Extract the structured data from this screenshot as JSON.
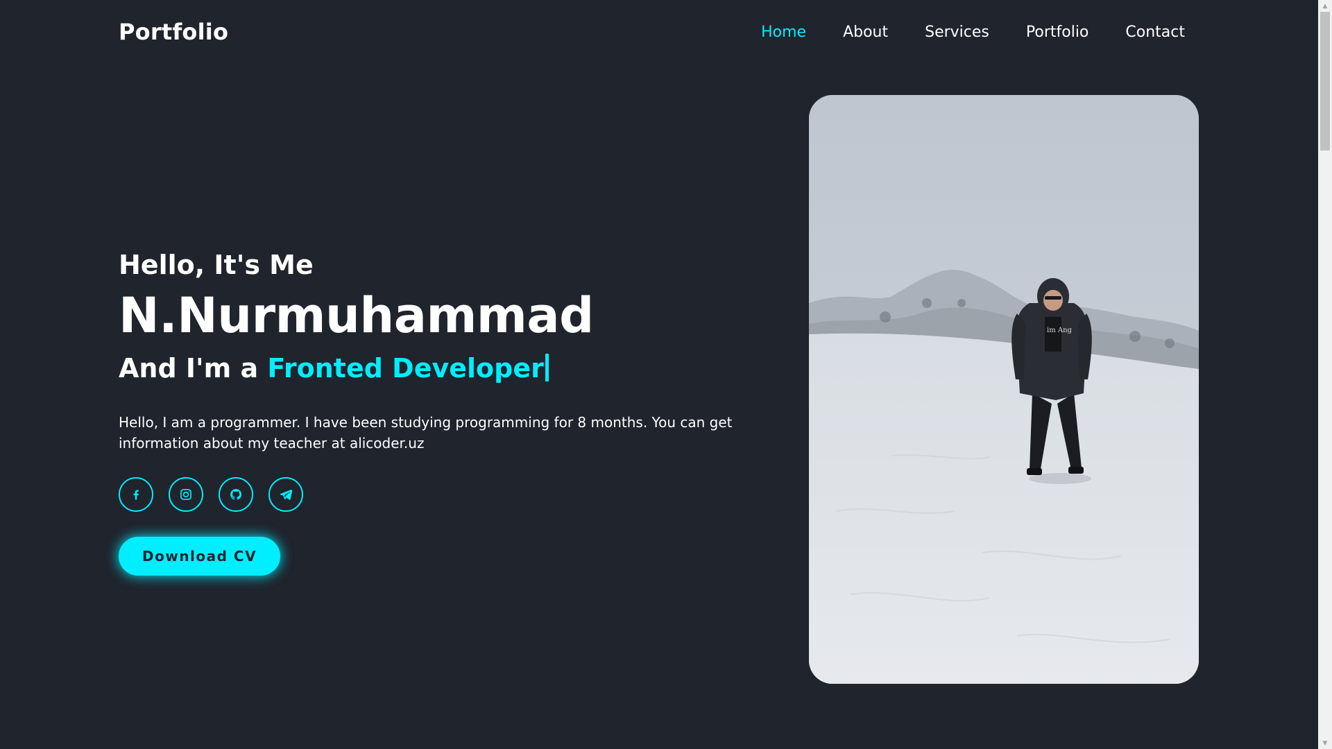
{
  "header": {
    "logo": "Portfolio",
    "nav": [
      {
        "label": "Home",
        "active": true
      },
      {
        "label": "About",
        "active": false
      },
      {
        "label": "Services",
        "active": false
      },
      {
        "label": "Portfolio",
        "active": false
      },
      {
        "label": "Contact",
        "active": false
      }
    ]
  },
  "hero": {
    "greeting": "Hello, It's Me",
    "name": "N.Nurmuhammad",
    "role_prefix": "And I'm a ",
    "role_highlight": "Fronted Developer",
    "description": "Hello, I am a programmer. I have been studying programming for 8 months. You can get information about my teacher at alicoder.uz",
    "socials": [
      {
        "icon": "facebook-icon"
      },
      {
        "icon": "instagram-icon"
      },
      {
        "icon": "github-icon"
      },
      {
        "icon": "telegram-icon"
      }
    ],
    "cv_button": "Download CV"
  },
  "photo": {
    "icon": "profile-photo",
    "shirt_text": "im Ang"
  },
  "colors": {
    "background": "#1f242d",
    "accent": "#00eeff",
    "text": "#ffffff"
  }
}
